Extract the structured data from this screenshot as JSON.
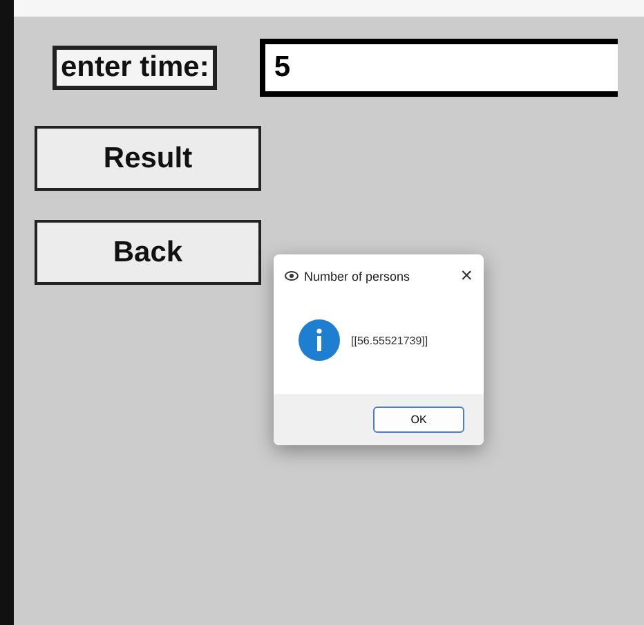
{
  "form": {
    "label": "enter time:",
    "input_value": "5",
    "buttons": [
      "Result",
      "Back"
    ]
  },
  "dialog": {
    "title": "Number of persons",
    "close": "×",
    "message": "[[56.55521739]]",
    "button": "OK"
  }
}
